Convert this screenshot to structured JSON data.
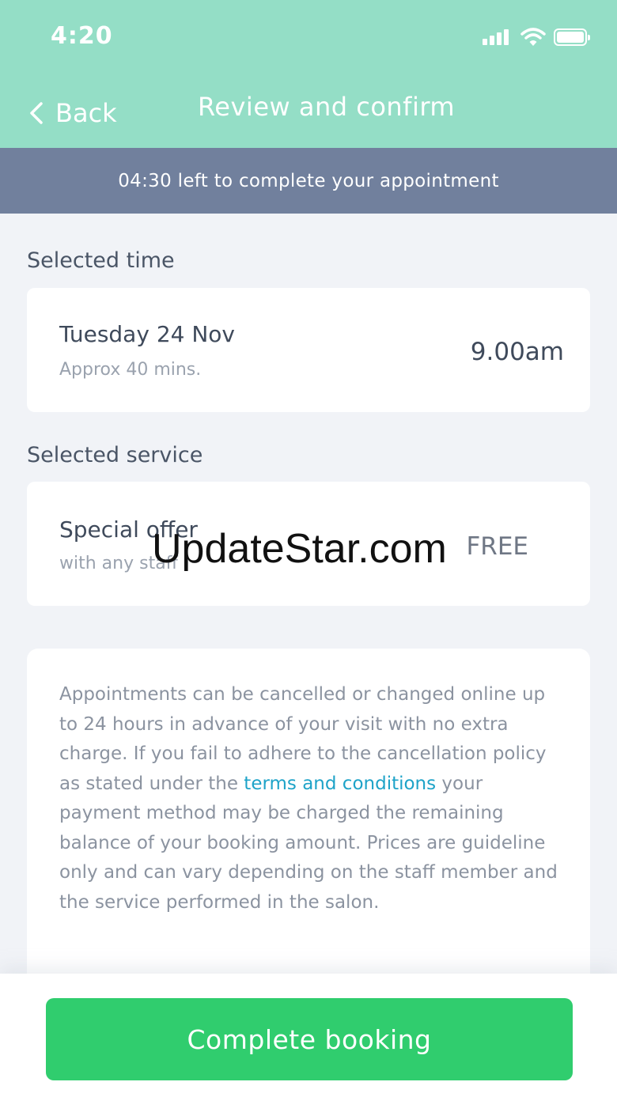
{
  "status_bar": {
    "time": "4:20"
  },
  "nav": {
    "back_label": "Back",
    "title": "Review and confirm"
  },
  "timer": {
    "text": "04:30 left to complete your appointment"
  },
  "selected_time": {
    "section_label": "Selected time",
    "date": "Tuesday 24 Nov",
    "duration": "Approx 40 mins.",
    "time": "9.00am"
  },
  "selected_service": {
    "section_label": "Selected service",
    "name": "Special offer",
    "staff": "with any staff",
    "price": "FREE"
  },
  "policy": {
    "text_before": "Appointments can be cancelled or changed online up to 24 hours in advance of your visit with no extra charge. If you fail to adhere to the cancellation policy as stated under the ",
    "link_text": "terms and conditions",
    "text_after": " your payment method may be charged the remaining balance of your booking amount. Prices are guideline only and can vary depending on the staff member and the service performed in the salon."
  },
  "action": {
    "complete_label": "Complete booking"
  },
  "watermark": "UpdateStar.com",
  "colors": {
    "header_bg": "#94dec6",
    "timer_bg": "#71809d",
    "button_bg": "#30cd6e",
    "link": "#1ea3c8"
  },
  "icons": {
    "back": "chevron-left-icon",
    "signal": "cellular-signal-icon",
    "wifi": "wifi-icon",
    "battery": "battery-icon"
  }
}
